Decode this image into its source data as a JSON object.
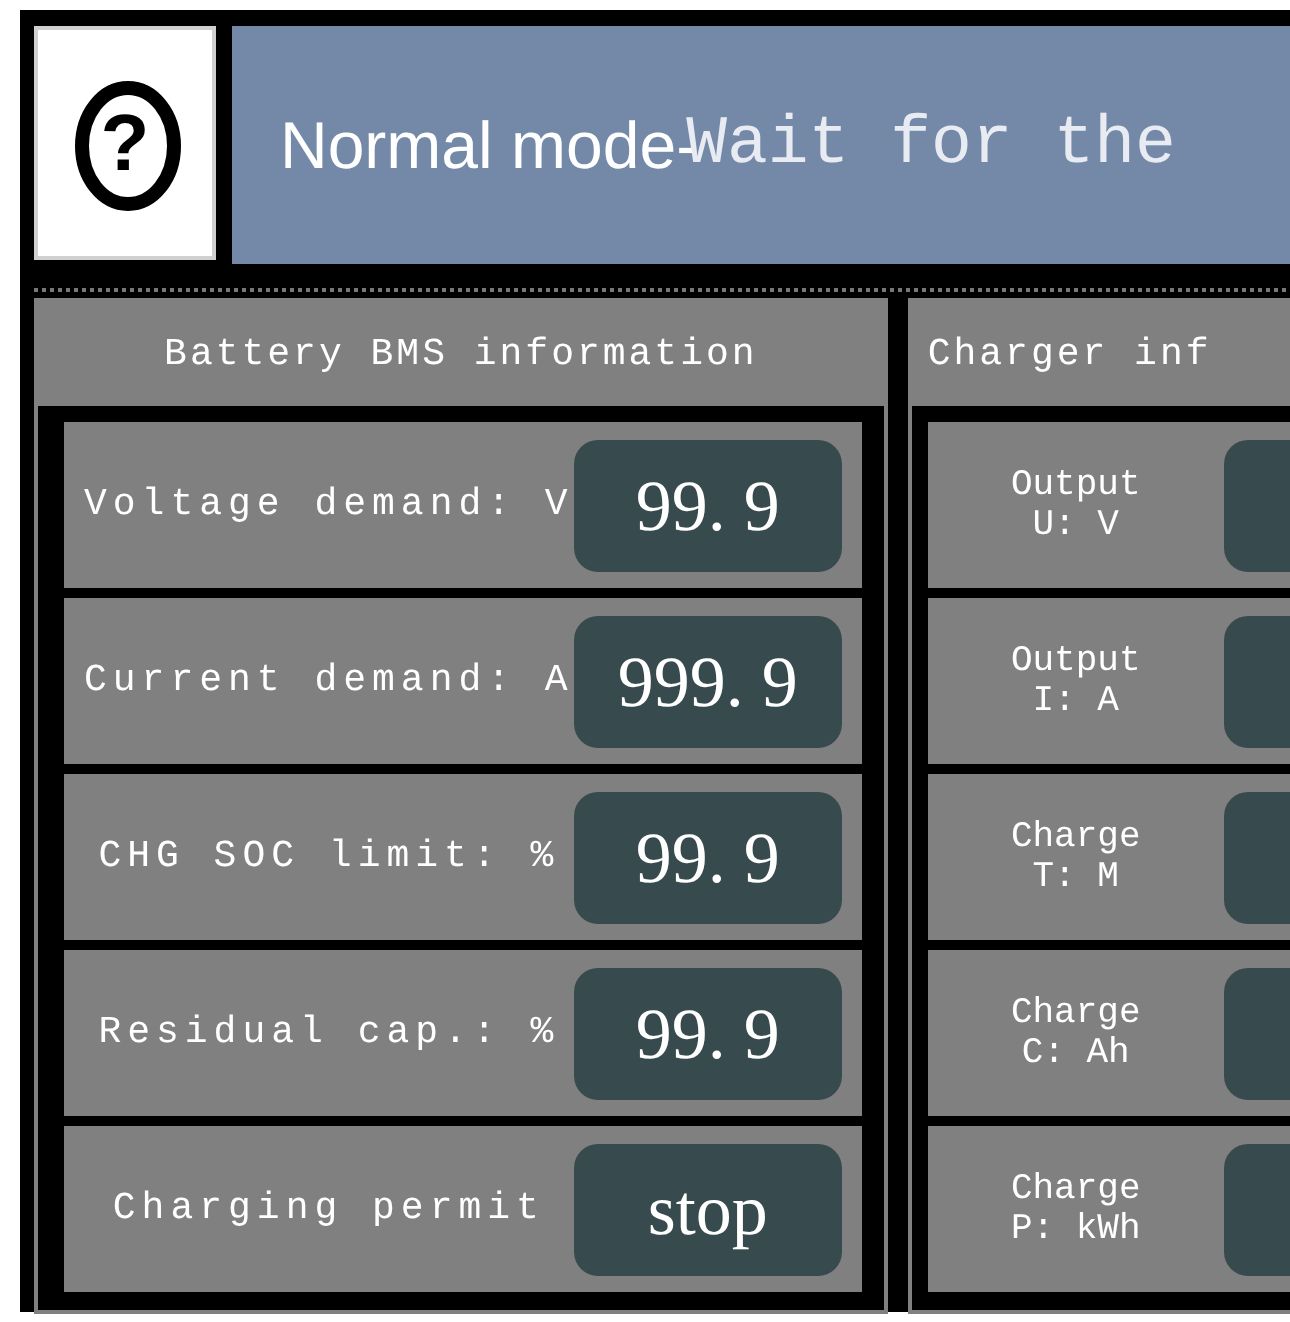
{
  "header": {
    "help_symbol": "?",
    "mode": "Normal mode-",
    "message": "Wait for the"
  },
  "battery_panel": {
    "title": "Battery BMS information",
    "rows": [
      {
        "label": "Voltage demand: V",
        "value": "99. 9"
      },
      {
        "label": "Current demand: A",
        "value": "999. 9"
      },
      {
        "label": "CHG SOC limit: %",
        "value": "99. 9"
      },
      {
        "label": "Residual cap.: %",
        "value": "99. 9"
      },
      {
        "label": "Charging permit",
        "value": "stop"
      }
    ]
  },
  "charger_panel": {
    "title": "Charger inf",
    "rows": [
      {
        "label": "Output\nU: V"
      },
      {
        "label": "Output\nI: A"
      },
      {
        "label": "Charge\nT: M"
      },
      {
        "label": "Charge\nC: Ah"
      },
      {
        "label": "Charge\nP: kWh"
      }
    ]
  }
}
